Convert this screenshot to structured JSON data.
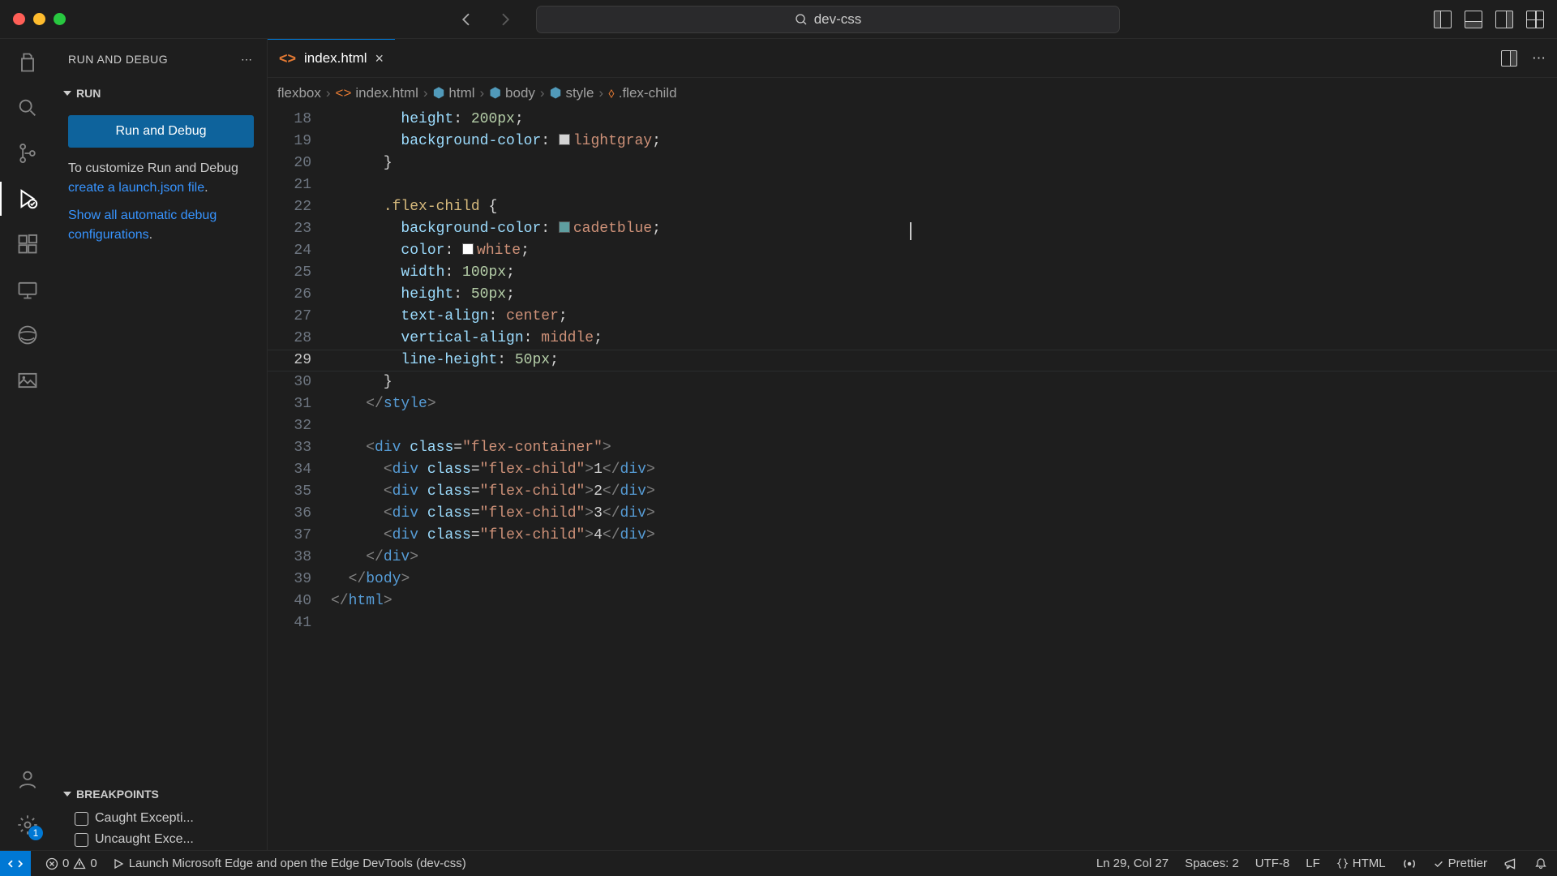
{
  "window": {
    "search_text": "dev-css"
  },
  "sidebar": {
    "title": "RUN AND DEBUG",
    "section_run": "RUN",
    "run_button": "Run and Debug",
    "customize_pre": "To customize Run and Debug ",
    "customize_link": "create a launch.json file",
    "customize_post": ".",
    "show_link": "Show all automatic debug configurations",
    "show_post": ".",
    "section_breakpoints": "BREAKPOINTS",
    "bp1": "Caught Excepti...",
    "bp2": "Uncaught Exce..."
  },
  "tab": {
    "name": "index.html"
  },
  "breadcrumbs": {
    "b1": "flexbox",
    "b2": "index.html",
    "b3": "html",
    "b4": "body",
    "b5": "style",
    "b6": ".flex-child"
  },
  "lines": {
    "start": 18,
    "end": 41,
    "current": 29
  },
  "code": {
    "l18_prop": "height",
    "l18_val": "200px",
    "l19_prop": "background-color",
    "l19_val": "lightgray",
    "l20": "}",
    "l22_sel": ".flex-child",
    "l23_prop": "background-color",
    "l23_val": "cadetblue",
    "l24_prop": "color",
    "l24_val": "white",
    "l25_prop": "width",
    "l25_val": "100px",
    "l26_prop": "height",
    "l26_val": "50px",
    "l27_prop": "text-align",
    "l27_val": "center",
    "l28_prop": "vertical-align",
    "l28_val": "middle",
    "l29_prop": "line-height",
    "l29_val": "50px",
    "l30": "}",
    "l31_tag": "style",
    "l33_tag": "div",
    "l33_attr": "class",
    "l33_val": "flex-container",
    "l34_tag": "div",
    "l34_attr": "class",
    "l34_val": "flex-child",
    "l34_txt": "1",
    "l35_txt": "2",
    "l36_txt": "3",
    "l37_txt": "4",
    "l38_tag": "div",
    "l39_tag": "body",
    "l40_tag": "html"
  },
  "status": {
    "remote_badge": "1",
    "errors": "0",
    "warnings": "0",
    "launch": "Launch Microsoft Edge and open the Edge DevTools (dev-css)",
    "ln": "Ln 29, Col 27",
    "spaces": "Spaces: 2",
    "encoding": "UTF-8",
    "eol": "LF",
    "lang": "HTML",
    "prettier": "Prettier"
  }
}
